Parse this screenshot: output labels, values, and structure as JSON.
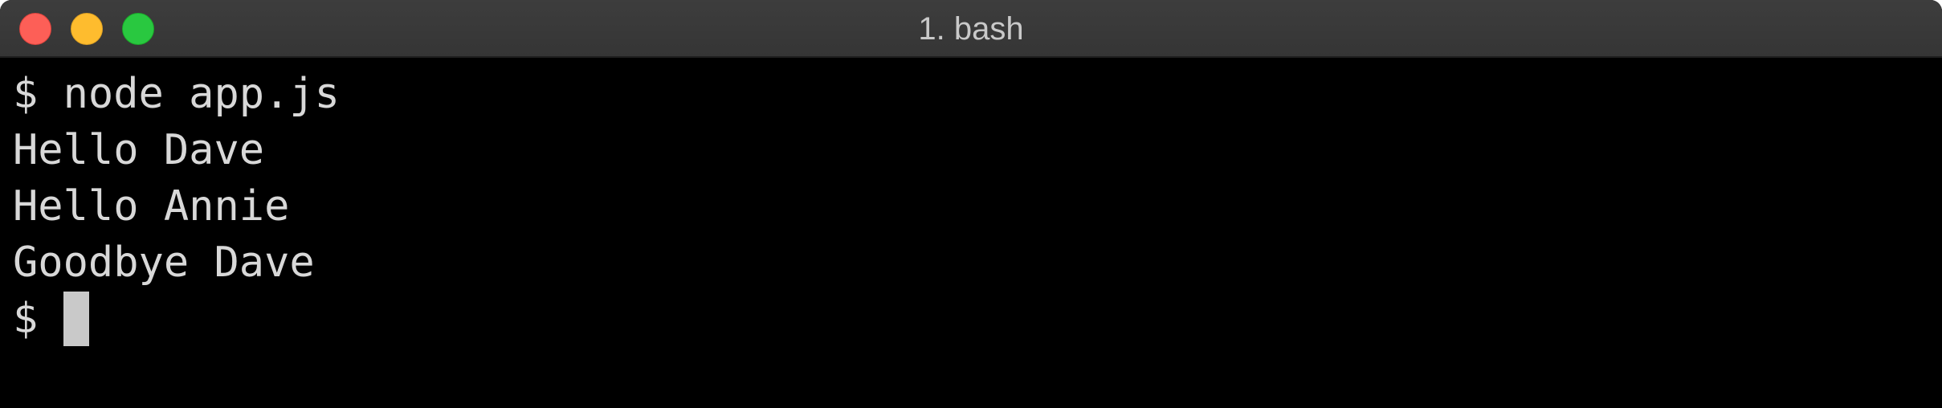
{
  "window": {
    "title": "1. bash"
  },
  "terminal": {
    "lines": [
      "$ node app.js",
      "Hello Dave",
      "Hello Annie",
      "Goodbye Dave"
    ],
    "prompt": "$ "
  }
}
